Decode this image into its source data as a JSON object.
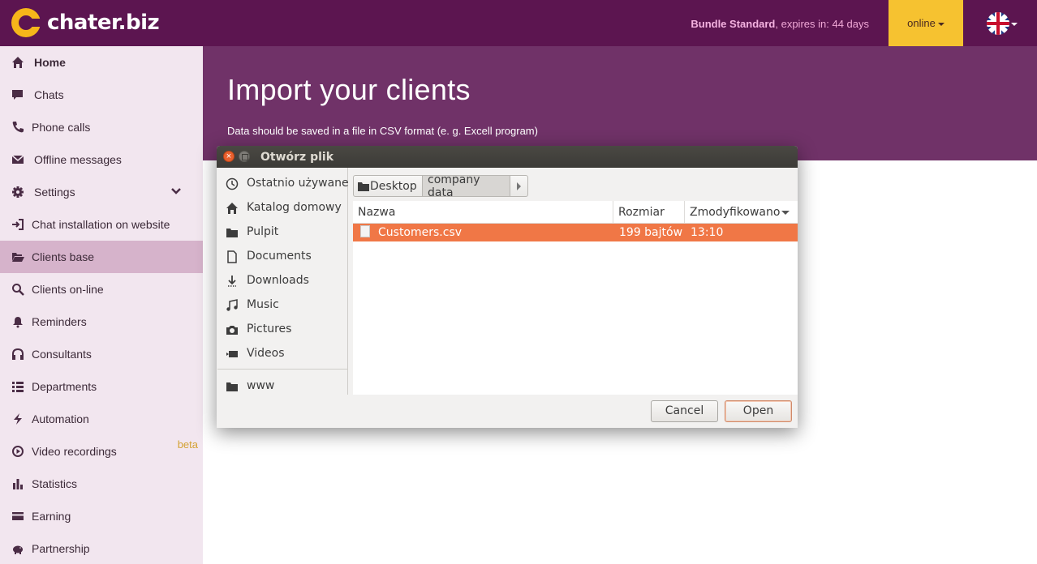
{
  "brand": {
    "name": "chater.biz"
  },
  "header": {
    "bundle_name": "Bundle Standard",
    "bundle_expiry": ", expires in: 44 days",
    "status_label": "online",
    "language_icon": "uk-flag-icon"
  },
  "sidebar": {
    "items": [
      {
        "label": "Home",
        "icon": "home-icon"
      },
      {
        "label": "Chats",
        "icon": "chat-bubble-icon"
      },
      {
        "label": "Phone calls",
        "icon": "phone-icon"
      },
      {
        "label": "Offline messages",
        "icon": "envelope-icon"
      },
      {
        "label": "Settings",
        "icon": "gear-icon"
      },
      {
        "label": "Chat installation on website",
        "icon": "sign-in-icon"
      },
      {
        "label": "Clients base",
        "icon": "folder-open-icon"
      },
      {
        "label": "Clients on-line",
        "icon": "search-icon"
      },
      {
        "label": "Reminders",
        "icon": "bell-icon"
      },
      {
        "label": "Consultants",
        "icon": "headphones-icon"
      },
      {
        "label": "Departments",
        "icon": "list-icon"
      },
      {
        "label": "Automation",
        "icon": "bolt-icon"
      },
      {
        "label": "Video recordings",
        "icon": "play-circle-icon",
        "badge": "beta"
      },
      {
        "label": "Statistics",
        "icon": "bar-chart-icon"
      },
      {
        "label": "Earning",
        "icon": "credit-card-icon"
      },
      {
        "label": "Partnership",
        "icon": "piggy-bank-icon"
      }
    ],
    "active_index": 6
  },
  "main": {
    "title": "Import your clients",
    "subtitle": "Data should be saved in a file in CSV format (e. g. Excell program)"
  },
  "dialog": {
    "title": "Otwórz plik",
    "places": [
      {
        "label": "Ostatnio używane",
        "icon": "clock-icon"
      },
      {
        "label": "Katalog domowy",
        "icon": "home-icon"
      },
      {
        "label": "Pulpit",
        "icon": "folder-icon"
      },
      {
        "label": "Documents",
        "icon": "document-icon"
      },
      {
        "label": "Downloads",
        "icon": "download-icon"
      },
      {
        "label": "Music",
        "icon": "music-icon"
      },
      {
        "label": "Pictures",
        "icon": "camera-icon"
      },
      {
        "label": "Videos",
        "icon": "video-icon"
      },
      {
        "label": "www",
        "icon": "folder-icon"
      }
    ],
    "path": [
      "Desktop",
      "company data"
    ],
    "columns": {
      "name": "Nazwa",
      "size": "Rozmiar",
      "modified": "Zmodyfikowano"
    },
    "files": [
      {
        "name": "Customers.csv",
        "size": "199 bajtów",
        "modified": "13:10",
        "selected": true
      }
    ],
    "buttons": {
      "cancel": "Cancel",
      "open": "Open"
    }
  },
  "colors": {
    "topbar": "#5c1550",
    "hero": "#703268",
    "sidebar": "#f2e6ef",
    "sidebar_active": "#d6b3cb",
    "accent": "#f6c230",
    "selection": "#f07746"
  }
}
